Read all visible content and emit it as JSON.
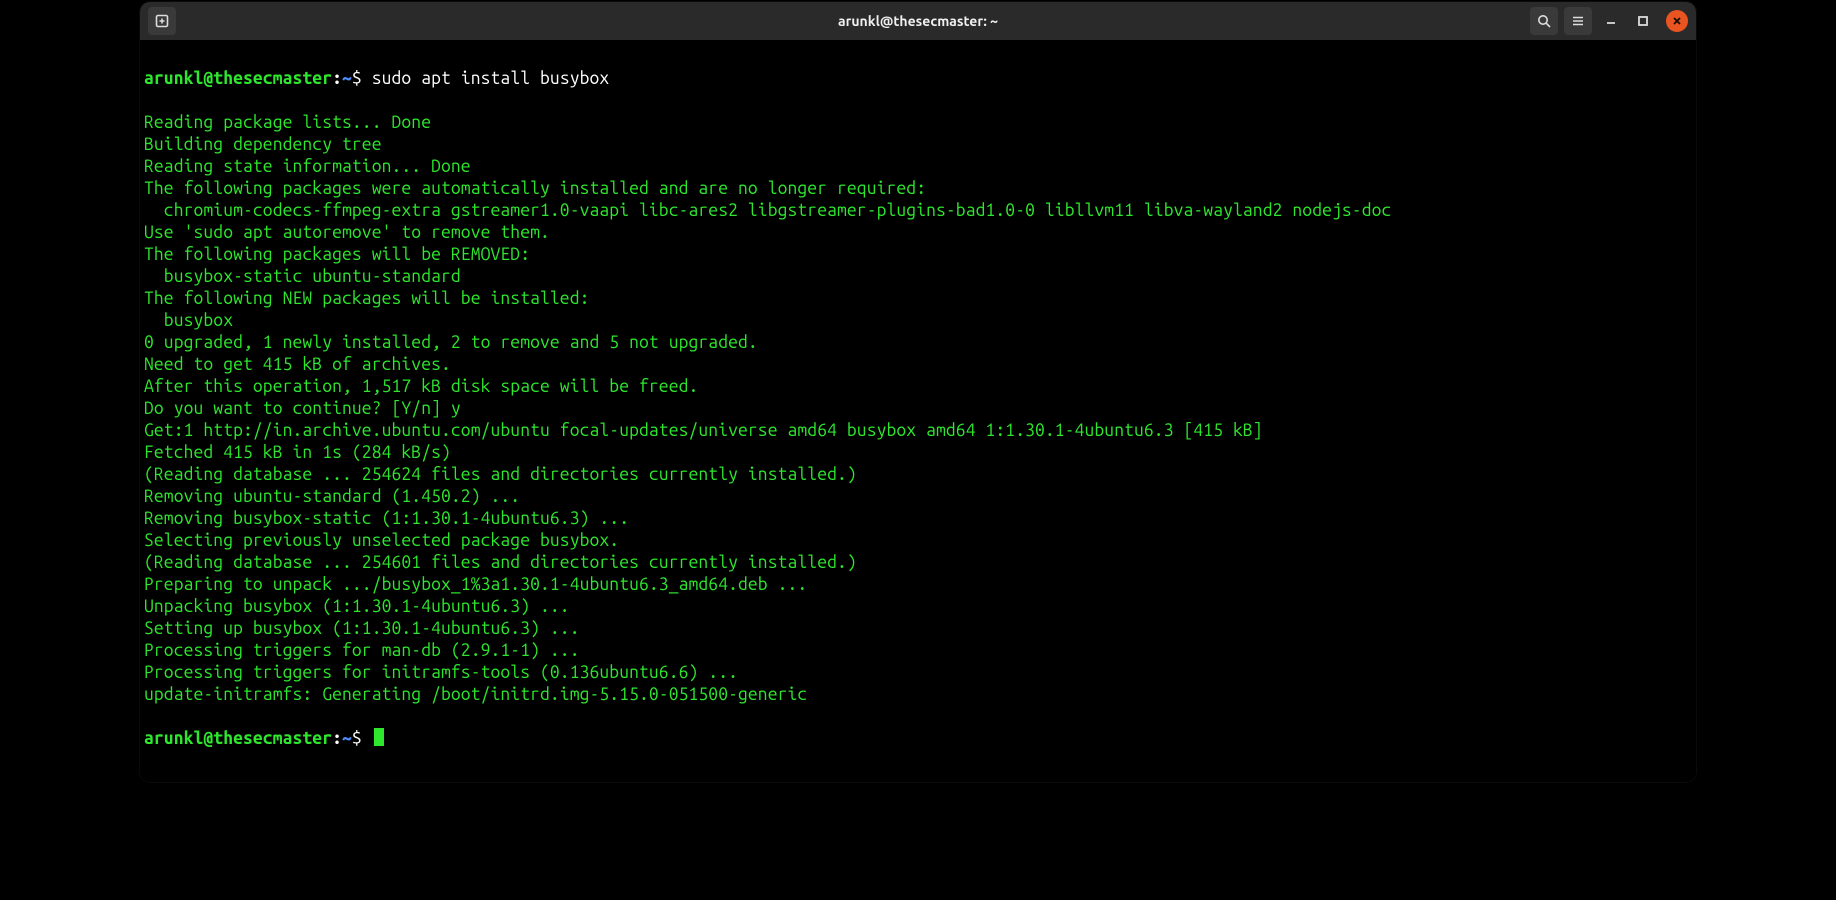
{
  "titlebar": {
    "title": "arunkl@thesecmaster: ~",
    "icons": {
      "new_tab": "new-tab-icon",
      "search": "search-icon",
      "menu": "hamburger-menu-icon",
      "minimize": "minimize-icon",
      "maximize": "maximize-icon",
      "close": "close-icon"
    }
  },
  "prompt": {
    "user_host": "arunkl@thesecmaster",
    "sep": ":",
    "path": "~",
    "symbol": "$"
  },
  "command1": "sudo apt install busybox",
  "output": [
    "Reading package lists... Done",
    "Building dependency tree",
    "Reading state information... Done",
    "The following packages were automatically installed and are no longer required:",
    "  chromium-codecs-ffmpeg-extra gstreamer1.0-vaapi libc-ares2 libgstreamer-plugins-bad1.0-0 libllvm11 libva-wayland2 nodejs-doc",
    "Use 'sudo apt autoremove' to remove them.",
    "The following packages will be REMOVED:",
    "  busybox-static ubuntu-standard",
    "The following NEW packages will be installed:",
    "  busybox",
    "0 upgraded, 1 newly installed, 2 to remove and 5 not upgraded.",
    "Need to get 415 kB of archives.",
    "After this operation, 1,517 kB disk space will be freed.",
    "Do you want to continue? [Y/n] y",
    "Get:1 http://in.archive.ubuntu.com/ubuntu focal-updates/universe amd64 busybox amd64 1:1.30.1-4ubuntu6.3 [415 kB]",
    "Fetched 415 kB in 1s (284 kB/s)",
    "(Reading database ... 254624 files and directories currently installed.)",
    "Removing ubuntu-standard (1.450.2) ...",
    "Removing busybox-static (1:1.30.1-4ubuntu6.3) ...",
    "Selecting previously unselected package busybox.",
    "(Reading database ... 254601 files and directories currently installed.)",
    "Preparing to unpack .../busybox_1%3a1.30.1-4ubuntu6.3_amd64.deb ...",
    "Unpacking busybox (1:1.30.1-4ubuntu6.3) ...",
    "Setting up busybox (1:1.30.1-4ubuntu6.3) ...",
    "Processing triggers for man-db (2.9.1-1) ...",
    "Processing triggers for initramfs-tools (0.136ubuntu6.6) ...",
    "update-initramfs: Generating /boot/initrd.img-5.15.0-051500-generic"
  ]
}
